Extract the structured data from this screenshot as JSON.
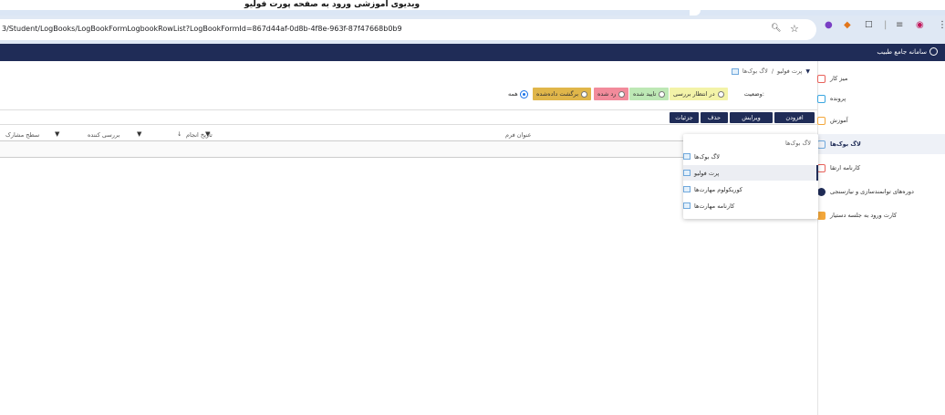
{
  "caption": "ویدیوی آموزشی ورود به صفحه پورت فولیو",
  "browser": {
    "url": "3/Student/LogBooks/LogBookFormLogbookRowList?LogBookFormId=867d44af-0d8b-4f8e-963f-87f47668b0b9",
    "zoom_icon": "zoom-icon",
    "bookmark_icon": "star-icon"
  },
  "header": {
    "brand": "سامانه جامع طبیب",
    "bg_color": "#1f2c57"
  },
  "sidebar": {
    "items": [
      {
        "label": "میز کار",
        "icon": "home-icon",
        "color": "#e8615a"
      },
      {
        "label": "پرونده",
        "icon": "folder-icon",
        "color": "#3aa6e0"
      },
      {
        "label": "آموزش",
        "icon": "education-icon",
        "color": "#f3a73b"
      },
      {
        "label": "لاگ بوک‌ها",
        "icon": "logbook-icon",
        "color": "#6fa8dc",
        "active": true
      },
      {
        "label": "کارنامه ارتقا",
        "icon": "report-icon",
        "color": "#e8615a"
      },
      {
        "label": "دوره‌های توانمندسازی و نیازسنجی",
        "icon": "course-icon",
        "color": "#1f2c57"
      },
      {
        "label": "کارت ورود به جلسه دستیار",
        "icon": "card-icon",
        "color": "#f3a73b"
      }
    ]
  },
  "breadcrumb": {
    "root": "لاگ بوک‌ها",
    "separator": "/",
    "current": "پرت فولیو"
  },
  "status_filter": {
    "label": "وضعیت:",
    "options": [
      {
        "label": "در انتظار بررسی",
        "color": "#f3f3a8",
        "checked": false
      },
      {
        "label": "تایید شده",
        "color": "#bde8b5",
        "checked": false
      },
      {
        "label": "رد شده",
        "color": "#f28b9b",
        "checked": false
      },
      {
        "label": "برگشت داده‌شده",
        "color": "#e0b64a",
        "checked": false
      },
      {
        "label": "همه",
        "color": "#ffffff",
        "checked": true
      }
    ]
  },
  "toolbar": {
    "add_label": "افزودن",
    "edit_label": "ویرایش",
    "delete_label": "حذف",
    "details_label": "جزئیات"
  },
  "table": {
    "columns": [
      "عنوان فرم",
      "تاریخ انجام",
      "بررسی کننده",
      "سطح مشارک"
    ]
  },
  "dropdown": {
    "header": "لاگ بوک‌ها",
    "items": [
      {
        "label": "لاگ بوک‌ها",
        "selected": false
      },
      {
        "label": "پرت فولیو",
        "selected": true
      },
      {
        "label": "کوریکولوم مهارت‌ها",
        "selected": false
      },
      {
        "label": "کارنامه مهارت‌ها",
        "selected": false
      }
    ]
  }
}
